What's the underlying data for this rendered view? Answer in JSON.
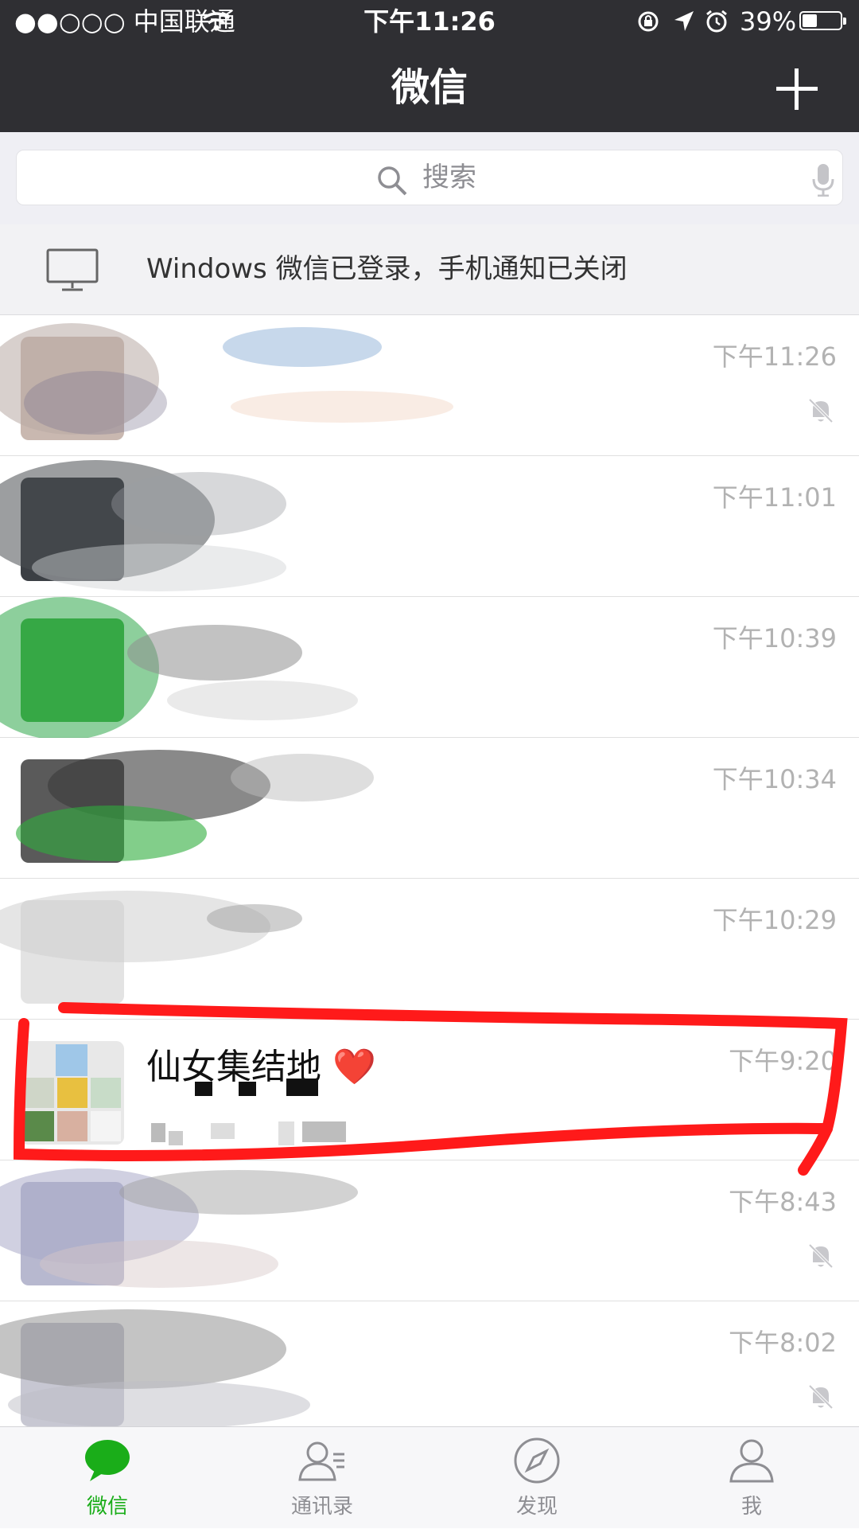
{
  "status_bar": {
    "carrier": "●●○○○ 中国联通",
    "time": "下午11:26",
    "battery": "39%"
  },
  "header": {
    "title": "微信",
    "add_icon": "plus-icon"
  },
  "search": {
    "placeholder": "搜索",
    "icon": "search-icon",
    "voice_icon": "microphone-icon"
  },
  "notice": {
    "icon": "monitor-icon",
    "text": "Windows 微信已登录，手机通知已关闭"
  },
  "chats": [
    {
      "name": "",
      "preview": "",
      "time": "下午11:26",
      "muted": true
    },
    {
      "name": "",
      "preview": "",
      "time": "下午11:01",
      "muted": false
    },
    {
      "name": "",
      "preview": "",
      "time": "下午10:39",
      "muted": false
    },
    {
      "name": "",
      "preview": "",
      "time": "下午10:34",
      "muted": false
    },
    {
      "name": "",
      "preview": "",
      "time": "下午10:29",
      "muted": false
    },
    {
      "name": "仙女集结地 ❤️",
      "preview": "",
      "time": "下午9:20",
      "muted": false
    },
    {
      "name": "",
      "preview": "",
      "time": "下午8:43",
      "muted": true
    },
    {
      "name": "",
      "preview": "",
      "time": "下午8:02",
      "muted": true
    }
  ],
  "tabs": [
    {
      "label": "微信",
      "icon": "chat-bubble-icon",
      "active": true
    },
    {
      "label": "通讯录",
      "icon": "contacts-icon",
      "active": false
    },
    {
      "label": "发现",
      "icon": "compass-icon",
      "active": false
    },
    {
      "label": "我",
      "icon": "person-icon",
      "active": false
    }
  ],
  "colors": {
    "header_bg": "#2f2f33",
    "accent": "#1aad19",
    "annotation": "#ff1a1a"
  }
}
